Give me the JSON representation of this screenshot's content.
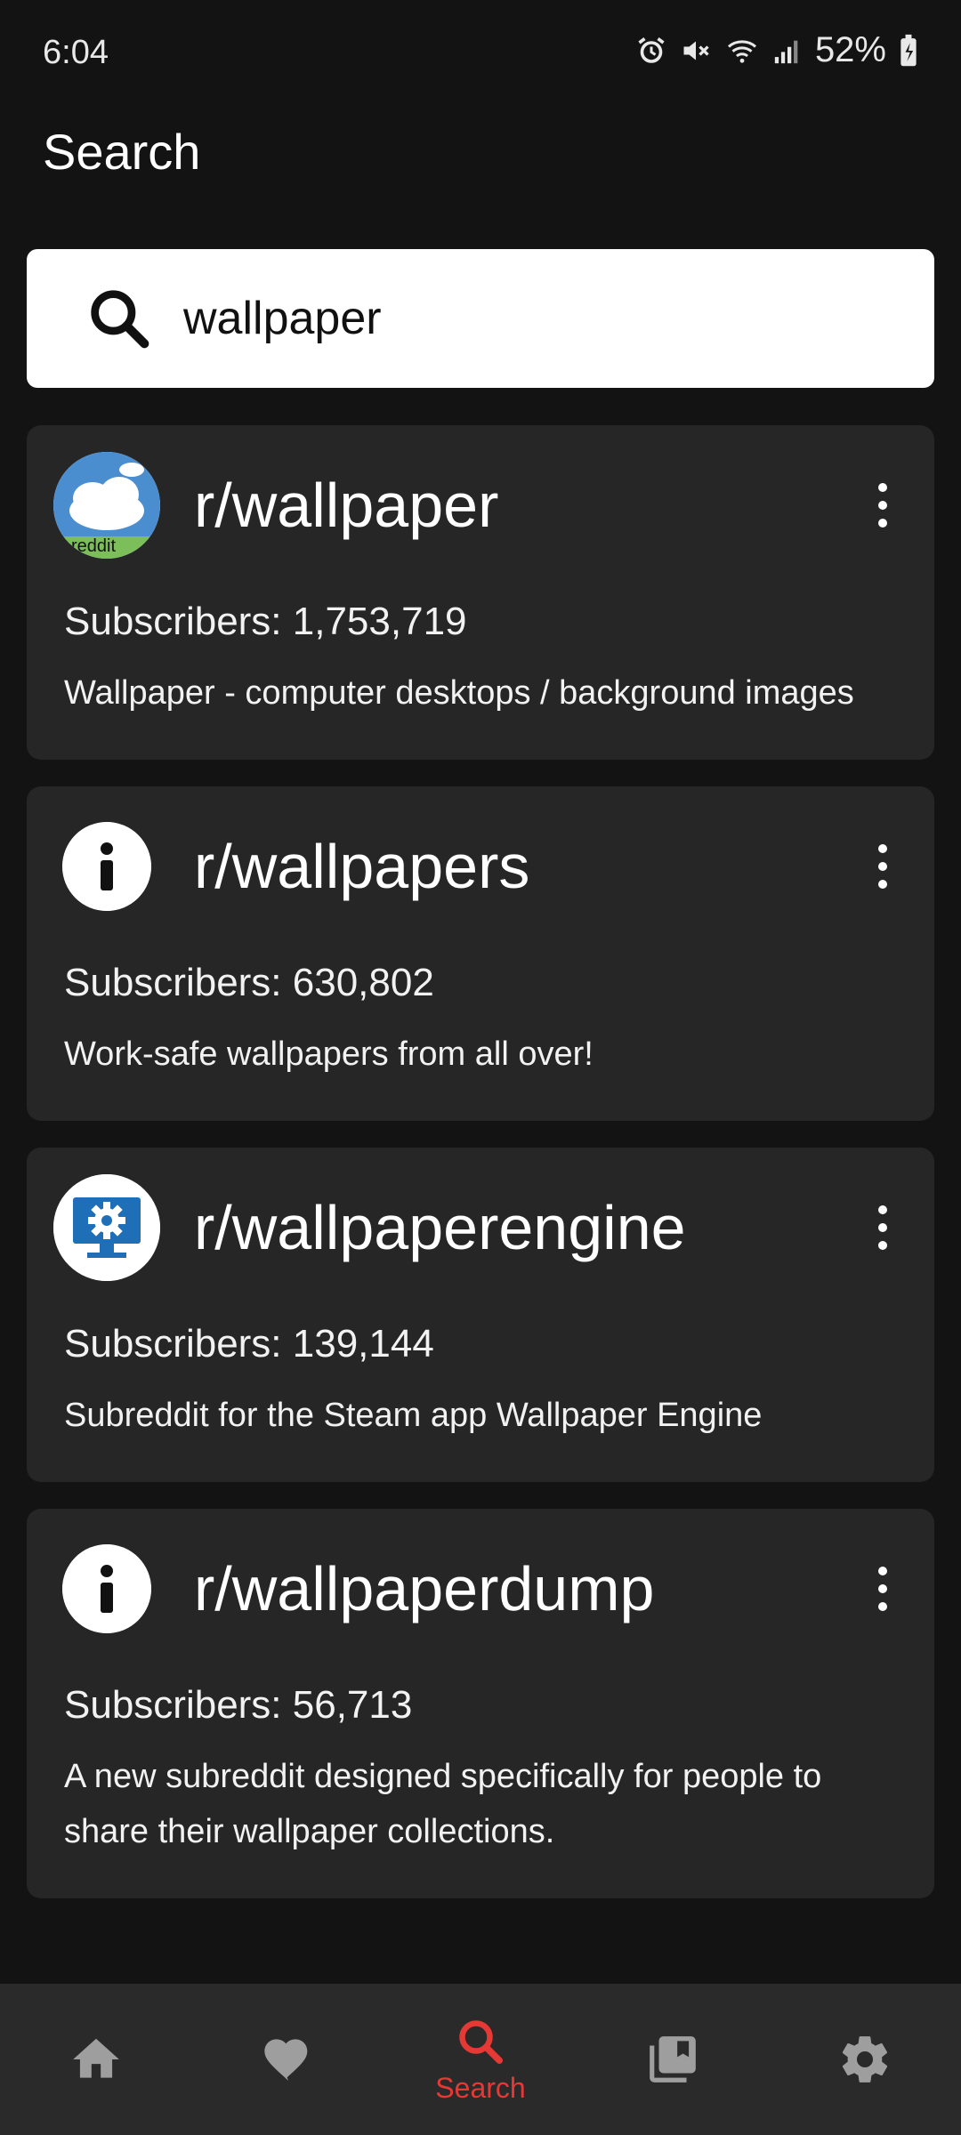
{
  "status_bar": {
    "time": "6:04",
    "battery": "52%"
  },
  "page": {
    "title": "Search"
  },
  "search": {
    "value": "wallpaper"
  },
  "results": [
    {
      "name": "r/wallpaper",
      "subscribers": "Subscribers: 1,753,719",
      "description": "Wallpaper - computer desktops / background images",
      "icon": "clouds-reddit-avatar"
    },
    {
      "name": "r/wallpapers",
      "subscribers": "Subscribers: 630,802",
      "description": "Work-safe wallpapers from all over!",
      "icon": "info-icon"
    },
    {
      "name": "r/wallpaperengine",
      "subscribers": "Subscribers: 139,144",
      "description": "Subreddit for the Steam app Wallpaper Engine",
      "icon": "gear-monitor-avatar"
    },
    {
      "name": "r/wallpaperdump",
      "subscribers": "Subscribers: 56,713",
      "description": "A new subreddit designed specifically for people to share their wallpaper collections.",
      "icon": "info-icon"
    }
  ],
  "bottom_nav": {
    "items": [
      {
        "icon": "home-icon"
      },
      {
        "icon": "heart-icon"
      },
      {
        "icon": "search-icon",
        "label": "Search",
        "active": true
      },
      {
        "icon": "library-icon"
      },
      {
        "icon": "gear-icon"
      }
    ]
  },
  "colors": {
    "background": "#131313",
    "card": "#262626",
    "nav": "#2a2a2a",
    "accent": "#e53935",
    "inactive_icon": "#9e9e9e"
  }
}
